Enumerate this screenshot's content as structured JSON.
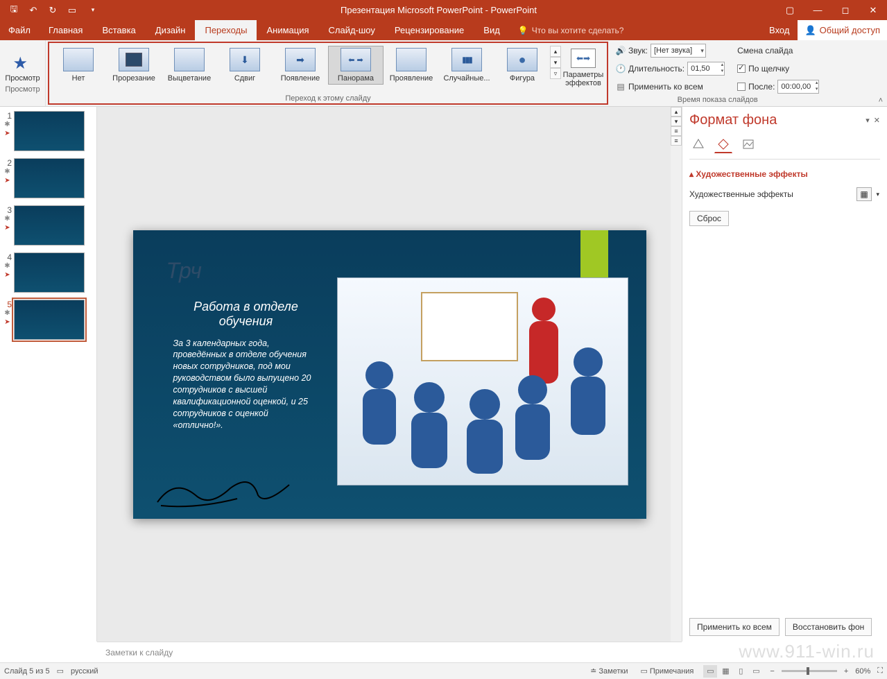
{
  "titlebar": {
    "title": "Презентация Microsoft PowerPoint - PowerPoint"
  },
  "tabs": {
    "file": "Файл",
    "items": [
      "Главная",
      "Вставка",
      "Дизайн",
      "Переходы",
      "Анимация",
      "Слайд-шоу",
      "Рецензирование",
      "Вид"
    ],
    "active_index": 3,
    "tellme": "Что вы хотите сделать?",
    "login": "Вход",
    "share": "Общий доступ"
  },
  "ribbon": {
    "preview": {
      "label": "Просмотр",
      "group": "Просмотр"
    },
    "transitions": [
      {
        "name": "Нет"
      },
      {
        "name": "Прорезание"
      },
      {
        "name": "Выцветание"
      },
      {
        "name": "Сдвиг"
      },
      {
        "name": "Появление"
      },
      {
        "name": "Панорама"
      },
      {
        "name": "Проявление"
      },
      {
        "name": "Случайные..."
      },
      {
        "name": "Фигура"
      }
    ],
    "selected_transition": 5,
    "effect_options": "Параметры эффектов",
    "group_caption": "Переход к этому слайду",
    "sound_label": "Звук:",
    "sound_value": "[Нет звука]",
    "duration_label": "Длительность:",
    "duration_value": "01,50",
    "apply_all": "Применить ко всем",
    "advance_header": "Смена слайда",
    "on_click": "По щелчку",
    "after_label": "После:",
    "after_value": "00:00,00",
    "timing_group": "Время показа слайдов"
  },
  "thumbs": {
    "count": 5,
    "current": 5
  },
  "slide": {
    "faded_title": "Трч",
    "subtitle": "Работа в отделе обучения",
    "paragraph": "За 3 календарных года, проведённых в отделе обучения новых сотрудников, под мои руководством было выпущено 20 сотрудников с высшей квалификационной оценкой, и 25 сотрудников с оценкой «отлично!»."
  },
  "pane": {
    "title": "Формат фона",
    "section": "Художественные эффекты",
    "row_label": "Художественные эффекты",
    "reset": "Сброс",
    "apply_all": "Применить ко всем",
    "restore": "Восстановить фон"
  },
  "notes_placeholder": "Заметки к слайду",
  "statusbar": {
    "slide": "Слайд 5 из 5",
    "lang": "русский",
    "notes": "Заметки",
    "comments": "Примечания",
    "zoom": "60%"
  },
  "watermark": "www.911-win.ru"
}
